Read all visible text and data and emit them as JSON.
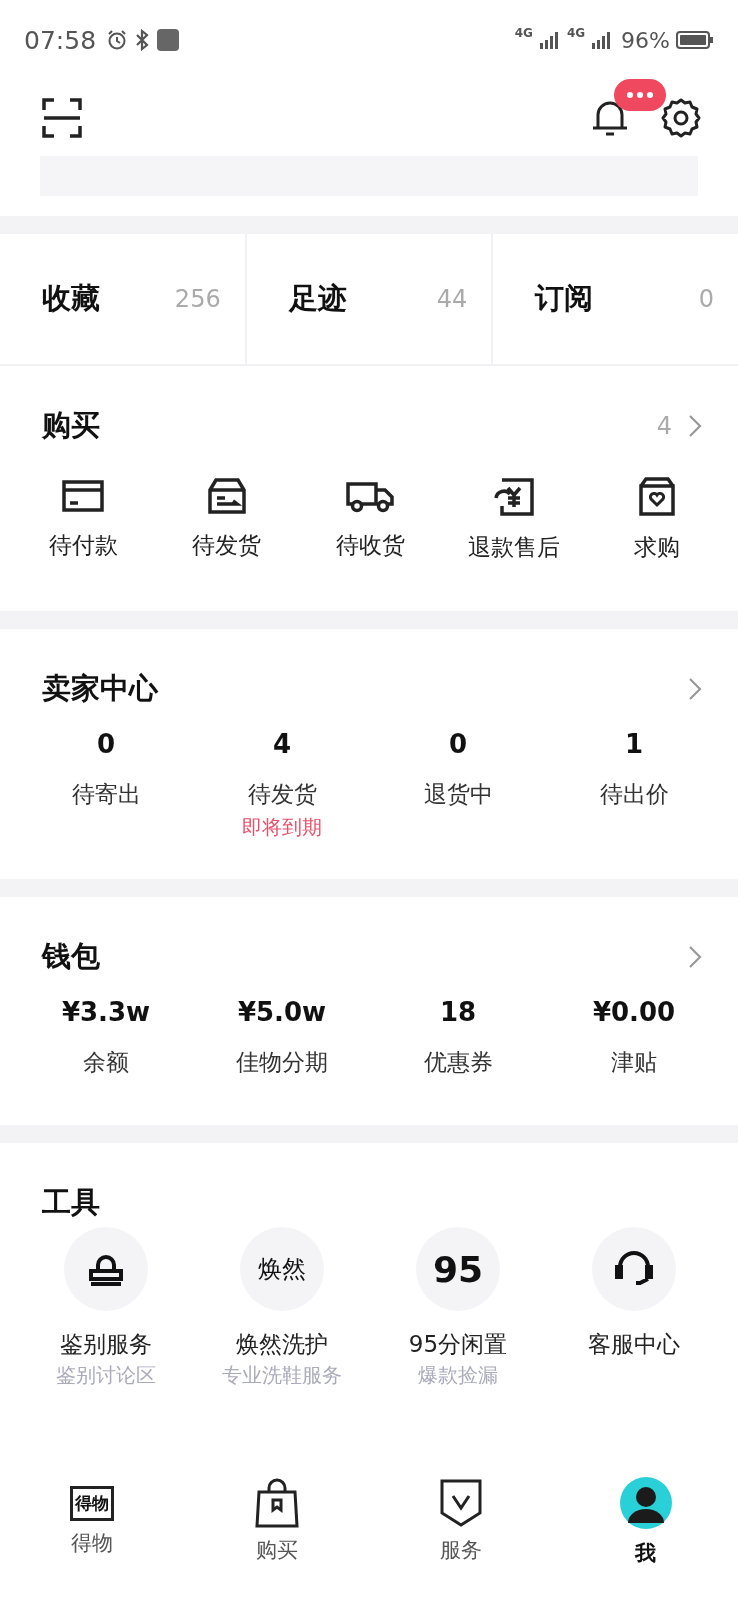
{
  "status_bar": {
    "time": "07:58",
    "networks": [
      "4G",
      "4G"
    ],
    "battery": "96%"
  },
  "stats": [
    {
      "label": "收藏",
      "count": "256"
    },
    {
      "label": "足迹",
      "count": "44"
    },
    {
      "label": "订阅",
      "count": "0"
    }
  ],
  "purchase": {
    "title": "购买",
    "count": "4",
    "items": [
      {
        "label": "待付款",
        "kind": "card"
      },
      {
        "label": "待发货",
        "kind": "box"
      },
      {
        "label": "待收货",
        "kind": "truck"
      },
      {
        "label": "退款售后",
        "kind": "refund"
      },
      {
        "label": "求购",
        "kind": "bag"
      }
    ]
  },
  "seller": {
    "title": "卖家中心",
    "items": [
      {
        "value": "0",
        "label": "待寄出"
      },
      {
        "value": "4",
        "label": "待发货",
        "note": "即将到期"
      },
      {
        "value": "0",
        "label": "退货中"
      },
      {
        "value": "1",
        "label": "待出价"
      }
    ]
  },
  "wallet": {
    "title": "钱包",
    "items": [
      {
        "value": "¥3.3w",
        "label": "余额"
      },
      {
        "value": "¥5.0w",
        "label": "佳物分期"
      },
      {
        "value": "18",
        "label": "优惠券"
      },
      {
        "value": "¥0.00",
        "label": "津贴"
      }
    ]
  },
  "tools": {
    "title": "工具",
    "items": [
      {
        "label": "鉴别服务",
        "sub": "鉴别讨论区",
        "kind": "stamp"
      },
      {
        "label": "焕然洗护",
        "sub": "专业洗鞋服务",
        "kind": "text",
        "icon_text": "焕然"
      },
      {
        "label": "95分闲置",
        "sub": "爆款捡漏",
        "kind": "text",
        "icon_text": "95"
      },
      {
        "label": "客服中心",
        "kind": "headset"
      }
    ]
  },
  "tabs": [
    {
      "label": "得物",
      "kind": "logo",
      "icon_text": "得物",
      "selected": false
    },
    {
      "label": "购买",
      "kind": "bag",
      "selected": false
    },
    {
      "label": "服务",
      "kind": "shield",
      "selected": false
    },
    {
      "label": "我",
      "kind": "avatar",
      "selected": true
    }
  ]
}
